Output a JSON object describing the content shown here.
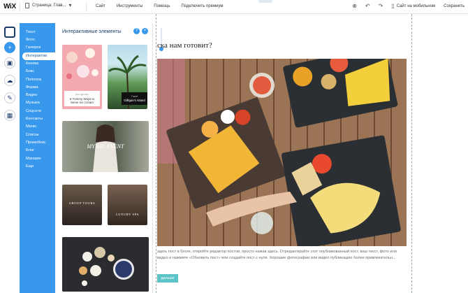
{
  "topbar": {
    "logo": "WiX",
    "page_selector": "Страница: Глав...",
    "menu": [
      "Сайт",
      "Инструменты",
      "Помощь",
      "Подключить премиум"
    ],
    "mobile_label": "Сайт на мобильном",
    "save_label": "Сохранить"
  },
  "sidebar": {
    "categories": [
      "Текст",
      "Фото",
      "Галерея",
      "Интерактив",
      "Кнопка",
      "Бокс",
      "Полоска",
      "Форма",
      "Видео",
      "Музыка",
      "Соцсети",
      "Контакты",
      "Меню",
      "Список",
      "Промобокс",
      "Блог",
      "Магазин",
      "Еще"
    ],
    "active_index": 3
  },
  "panel": {
    "title": "Интерактивные элементы",
    "help_label": "?",
    "close_label": "×",
    "thumbs": {
      "t1_caption_small": "Как сделать",
      "t1_caption": "5 Yummy Ways to Serve Ice Cream",
      "t2_caption_small": "Travel",
      "t2_caption": "Gilligan's Island",
      "t3_title": "MY BIG EVENT",
      "t4_title": "GROUP TOURS",
      "t5_title": "LUXURY SPA"
    }
  },
  "canvas": {
    "post_title": "ска нам готовит?",
    "post_text": "здать пост в блоге, откройте редактор постов, просто нажав здесь. Отредактируйте этот опубликованный пост, ваш текст, фото или видео и нажмите «Обновить пост» или создайте пост с нуля. Хорошие фотографии или видео публикацию более привлекательн...",
    "read_more": "дальше"
  },
  "colors": {
    "accent": "#3899ec",
    "button_teal": "#5cc4c8"
  }
}
